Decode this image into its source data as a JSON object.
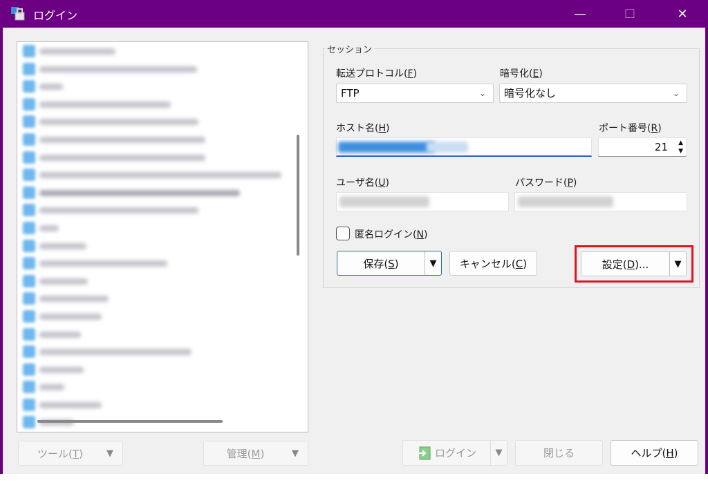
{
  "window": {
    "title": "ログイン",
    "min": "—",
    "max": "☐",
    "close": "✕"
  },
  "session": {
    "group_label": "セッション",
    "protocol_label_pre": "転送プロトコル(",
    "protocol_label_key": "F",
    "protocol_label_post": ")",
    "protocol_value": "FTP",
    "encryption_label_pre": "暗号化(",
    "encryption_label_key": "E",
    "encryption_label_post": ")",
    "encryption_value": "暗号化なし",
    "host_label_pre": "ホスト名(",
    "host_label_key": "H",
    "host_label_post": ")",
    "port_label_pre": "ポート番号(",
    "port_label_key": "R",
    "port_label_post": ")",
    "port_value": "21",
    "user_label_pre": "ユーザ名(",
    "user_label_key": "U",
    "user_label_post": ")",
    "password_label_pre": "パスワード(",
    "password_label_key": "P",
    "password_label_post": ")",
    "anon_label_pre": "匿名ログイン(",
    "anon_label_key": "N",
    "anon_label_post": ")",
    "save_pre": "保存(",
    "save_key": "S",
    "save_post": ")",
    "cancel_pre": "キャンセル(",
    "cancel_key": "C",
    "cancel_post": ")",
    "settings_pre": "設定(",
    "settings_key": "D",
    "settings_post": ")..."
  },
  "footer": {
    "tools_pre": "ツール(",
    "tools_key": "T",
    "tools_post": ")",
    "manage_pre": "管理(",
    "manage_key": "M",
    "manage_post": ")",
    "login": "ログイン",
    "close": "閉じる",
    "help_pre": "ヘルプ(",
    "help_key": "H",
    "help_post": ")"
  },
  "icons": {
    "dropdown": "▼",
    "chevron": "⌄",
    "spin_up": "▲",
    "spin_down": "▼"
  },
  "colors": {
    "titlebar": "#6c0082",
    "accent": "#2a64c4",
    "highlight": "#e0141e"
  }
}
